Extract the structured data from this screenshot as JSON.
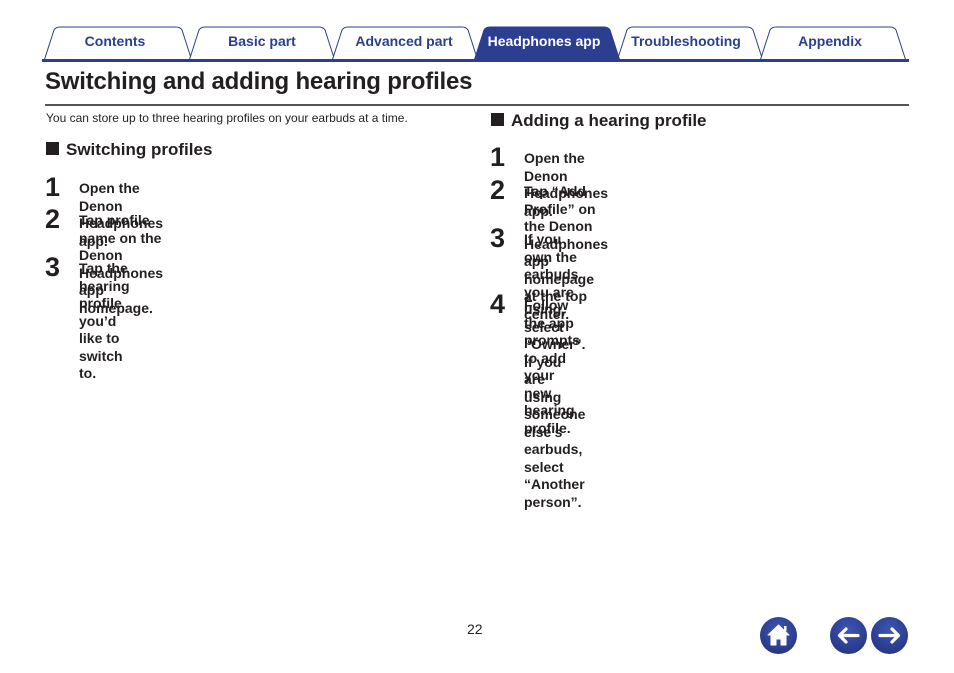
{
  "tabs": [
    {
      "label": "Contents",
      "active": false
    },
    {
      "label": "Basic part",
      "active": false
    },
    {
      "label": "Advanced part",
      "active": false
    },
    {
      "label": "Headphones app",
      "active": true
    },
    {
      "label": "Troubleshooting",
      "active": false
    },
    {
      "label": "Appendix",
      "active": false
    }
  ],
  "page": {
    "title": "Switching and adding hearing profiles",
    "intro": "You can store up to three hearing profiles on your earbuds at a time.",
    "page_number": "22"
  },
  "sections": [
    {
      "heading": "Switching profiles",
      "steps": [
        {
          "num": "1",
          "text": "Open the Denon Headphones app."
        },
        {
          "num": "2",
          "text": "Tap profile name on the Denon Headphones app\nhomepage."
        },
        {
          "num": "3",
          "text": "Tap the hearing profile you’d like to switch to."
        }
      ]
    },
    {
      "heading": "Adding a hearing profile",
      "steps": [
        {
          "num": "1",
          "text": "Open the Denon Headphones app."
        },
        {
          "num": "2",
          "text": "Tap “Add Profile” on the Denon Headphones app\nhomepage at the top center."
        },
        {
          "num": "3",
          "text": "If you own the earbuds you are using, select “Owner”.\nIf you are using someone else’s earbuds, select\n“Another person”."
        },
        {
          "num": "4",
          "text": "Follow the app prompts to add your new hearing\nprofile."
        }
      ]
    }
  ],
  "nav": {
    "home_icon": "home-icon",
    "back_icon": "arrow-left-icon",
    "forward_icon": "arrow-right-icon"
  },
  "colors": {
    "accent": "#2c3e8f",
    "text": "#231f20"
  }
}
